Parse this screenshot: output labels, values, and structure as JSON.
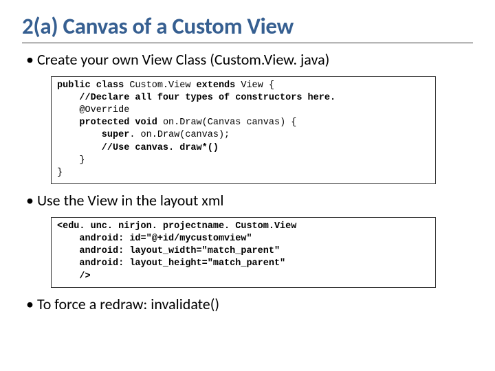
{
  "title": "2(a) Canvas of a Custom View",
  "bullets": {
    "b1": "Create your own View Class (Custom.View. java)",
    "b2": "Use the View in the layout xml",
    "b3": "To force a redraw: invalidate()"
  },
  "code1": {
    "l1a": "public class ",
    "l1b": "Custom.View ",
    "l1c": "extends ",
    "l1d": "View {",
    "l2a": "    //Declare all four types of constructors here.",
    "l3a": "    @Override",
    "l4a": "    protected void ",
    "l4b": "on.Draw(Canvas canvas) {",
    "l5a": "        super",
    "l5b": ". on.Draw(canvas);",
    "l6a": "        //Use canvas. draw*()",
    "l7a": "    }",
    "l8a": "}"
  },
  "code2": {
    "l1": "<edu. unc. nirjon. projectname. Custom.View",
    "l2": "    android: id=\"@+id/mycustomview\"",
    "l3": "    android: layout_width=\"match_parent\"",
    "l4": "    android: layout_height=\"match_parent\"",
    "l5": "    />"
  }
}
